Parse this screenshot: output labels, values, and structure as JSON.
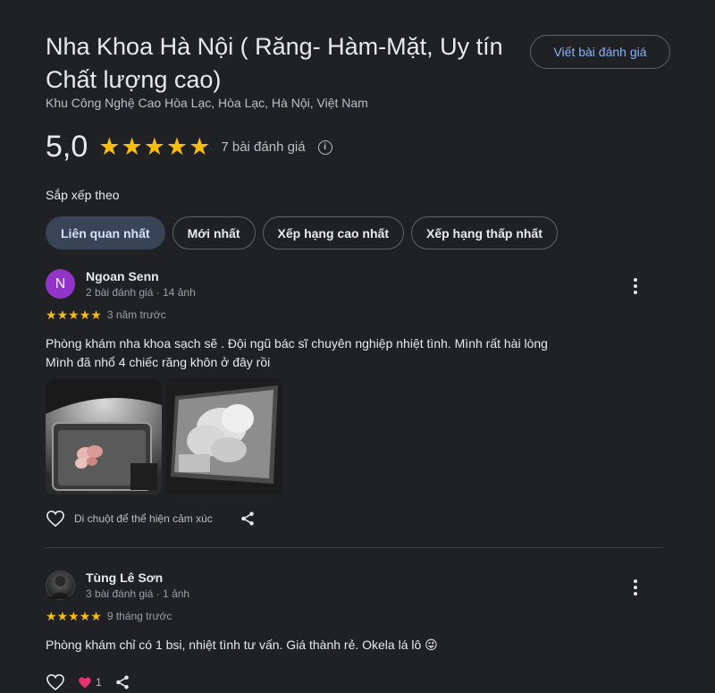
{
  "place": {
    "title": "Nha Khoa Hà Nội ( Răng- Hàm-Mặt, Uy tín Chất lượng cao)",
    "address": "Khu Công Nghệ Cao Hòa Lạc, Hòa Lạc, Hà Nội, Việt Nam",
    "write_review_label": "Viết bài đánh giá",
    "rating_value": "5,0",
    "stars": 5,
    "review_count_label": "7 bài đánh giá"
  },
  "sort": {
    "label": "Sắp xếp theo",
    "chips": [
      {
        "label": "Liên quan nhất",
        "active": true
      },
      {
        "label": "Mới nhất",
        "active": false
      },
      {
        "label": "Xếp hạng cao nhất",
        "active": false
      },
      {
        "label": "Xếp hạng thấp nhất",
        "active": false
      }
    ]
  },
  "reviews": [
    {
      "avatar_letter": "N",
      "avatar_color": "#9334c9",
      "name": "Ngoan Senn",
      "meta": "2 bài đánh giá · 14 ảnh",
      "stars": 5,
      "time": "3 năm trước",
      "text_lines": [
        "Phòng khám nha khoa sạch sẽ . Đội ngũ bác sĩ chuyên nghiệp nhiệt tình. Mình rất hài lòng",
        "Mình đã nhổ 4 chiếc răng khôn ở đây rồi"
      ],
      "hover_hint": "Di chuột để thể hiện cảm xúc"
    },
    {
      "name": "Tùng Lê Sơn",
      "meta": "3 bài đánh giá · 1 ảnh",
      "stars": 5,
      "time": "9 tháng trước",
      "text": "Phòng khám chỉ có 1 bsi, nhiệt tình tư vấn. Giá thành rẻ. Okela lá lô 😜",
      "reaction_count": "1"
    }
  ],
  "colors": {
    "background": "#202124",
    "star": "#fbbc04",
    "link": "#8ab4f8",
    "active_chip": "#394457"
  }
}
